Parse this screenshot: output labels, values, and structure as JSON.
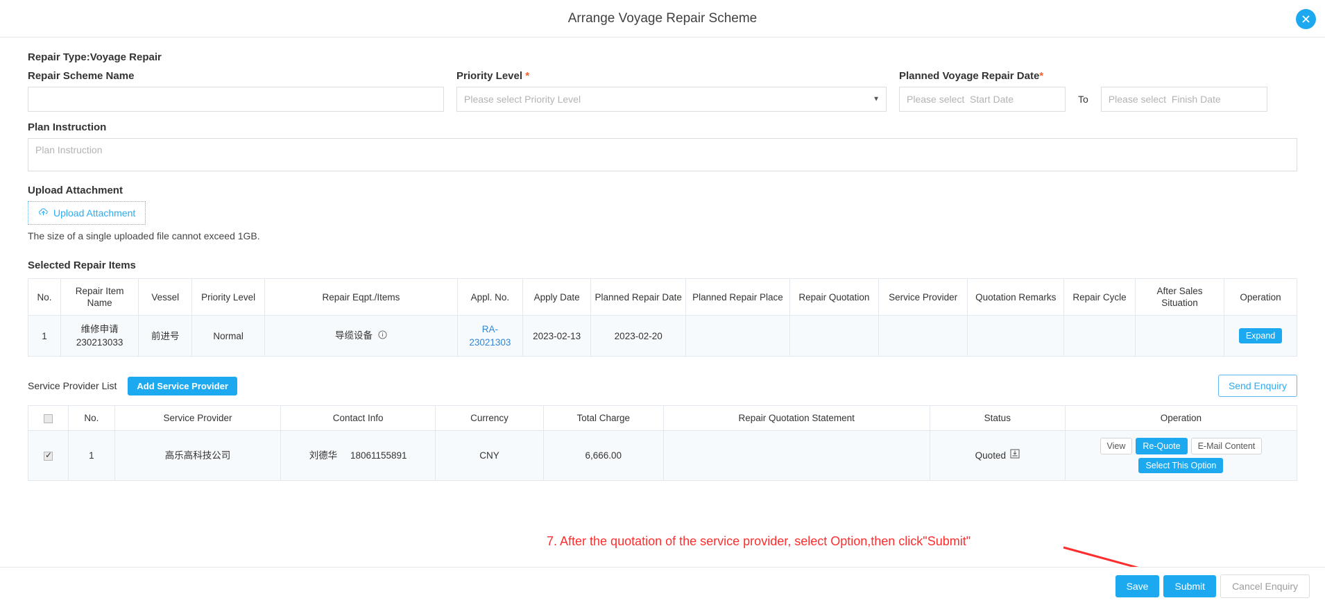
{
  "dialog": {
    "title": "Arrange Voyage Repair Scheme",
    "close_icon": "close-icon"
  },
  "form": {
    "repair_type": "Repair Type:Voyage Repair",
    "scheme_name_label": "Repair Scheme Name",
    "scheme_name_value": "",
    "scheme_name_placeholder": "",
    "priority_label": "Priority Level",
    "priority_required": "*",
    "priority_value": "Please select Priority Level",
    "planned_date_label": "Planned Voyage Repair Date",
    "planned_date_required": "*",
    "start_date_placeholder": "Please select  Start Date",
    "finish_date_placeholder": "Please select  Finish Date",
    "to_label": "To",
    "plan_instruction_label": "Plan Instruction",
    "plan_instruction_placeholder": "Plan Instruction",
    "upload_label": "Upload Attachment",
    "upload_button": "Upload Attachment",
    "upload_icon": "cloud-upload-icon",
    "upload_hint": "The size of a single uploaded file cannot exceed 1GB."
  },
  "repair_items": {
    "title": "Selected Repair Items",
    "columns": [
      "No.",
      "Repair Item Name",
      "Vessel",
      "Priority Level",
      "Repair Eqpt./Items",
      "Appl. No.",
      "Apply Date",
      "Planned Repair Date",
      "Planned Repair Place",
      "Repair Quotation",
      "Service Provider",
      "Quotation Remarks",
      "Repair Cycle",
      "After Sales Situation",
      "Operation"
    ],
    "rows": [
      {
        "no": "1",
        "item_name": "维修申请230213033",
        "vessel": "前进号",
        "priority": "Normal",
        "eqpt": "导缆设备",
        "eqpt_info_icon": "info-circle-icon",
        "appl_no": "RA-23021303",
        "apply_date": "2023-02-13",
        "planned_repair_date": "2023-02-20",
        "planned_repair_place": "",
        "repair_quotation": "",
        "service_provider": "",
        "quotation_remarks": "",
        "repair_cycle": "",
        "after_sales": "",
        "operation": "Expand"
      }
    ]
  },
  "service_providers": {
    "list_label": "Service Provider List",
    "add_button": "Add Service Provider",
    "send_enquiry_button": "Send Enquiry",
    "select_all_checked": false,
    "columns": [
      "",
      "No.",
      "Service Provider",
      "Contact Info",
      "Currency",
      "Total Charge",
      "Repair Quotation Statement",
      "Status",
      "Operation"
    ],
    "rows": [
      {
        "checked": true,
        "no": "1",
        "provider": "高乐高科技公司",
        "contact_name": "刘德华",
        "contact_phone": "18061155891",
        "currency": "CNY",
        "total_charge": "6,666.00",
        "quotation_statement": "",
        "status": "Quoted",
        "status_icon": "download-box-icon",
        "op_view": "View",
        "op_requote": "Re-Quote",
        "op_email": "E-Mail Content",
        "op_select": "Select This Option"
      }
    ]
  },
  "annotation": {
    "text": "7. After the quotation of the service provider, select Option,then click\"Submit\"",
    "color": "#ff2d2d",
    "arrow_icon": "arrow-pointer-icon"
  },
  "footer": {
    "save": "Save",
    "submit": "Submit",
    "cancel_enquiry": "Cancel Enquiry"
  },
  "colors": {
    "accent": "#1DA9F0",
    "link": "#2f86d6",
    "required": "#f5602a",
    "annotation": "#ff2d2d"
  }
}
